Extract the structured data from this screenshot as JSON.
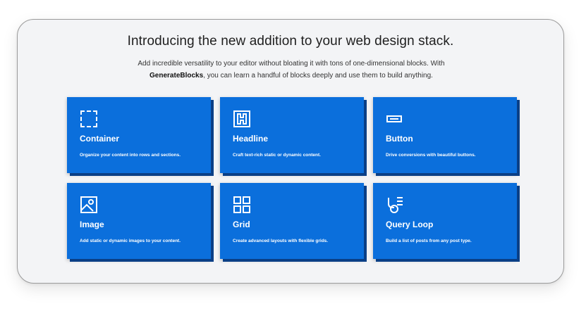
{
  "heading": "Introducing the new addition to your web design stack.",
  "intro": {
    "line1": "Add incredible versatility to your editor without bloating it with tons of one-dimensional blocks. With",
    "brand": "GenerateBlocks",
    "line2": ", you can learn a handful of blocks deeply and use them to build anything."
  },
  "cards": [
    {
      "icon": "container-icon",
      "title": "Container",
      "desc": "Organize your content into rows and sections."
    },
    {
      "icon": "headline-icon",
      "title": "Headline",
      "desc": "Craft text-rich static or dynamic content."
    },
    {
      "icon": "button-icon",
      "title": "Button",
      "desc": "Drive conversions with beautiful buttons."
    },
    {
      "icon": "image-icon",
      "title": "Image",
      "desc": "Add static or dynamic images to your content."
    },
    {
      "icon": "grid-icon",
      "title": "Grid",
      "desc": "Create advanced layouts with flexible grids."
    },
    {
      "icon": "query-loop-icon",
      "title": "Query Loop",
      "desc": "Build a list of posts from any post type."
    }
  ],
  "colors": {
    "card": "#0b6fdc",
    "card_shadow": "#0a3f86",
    "panel": "#f3f4f6"
  }
}
